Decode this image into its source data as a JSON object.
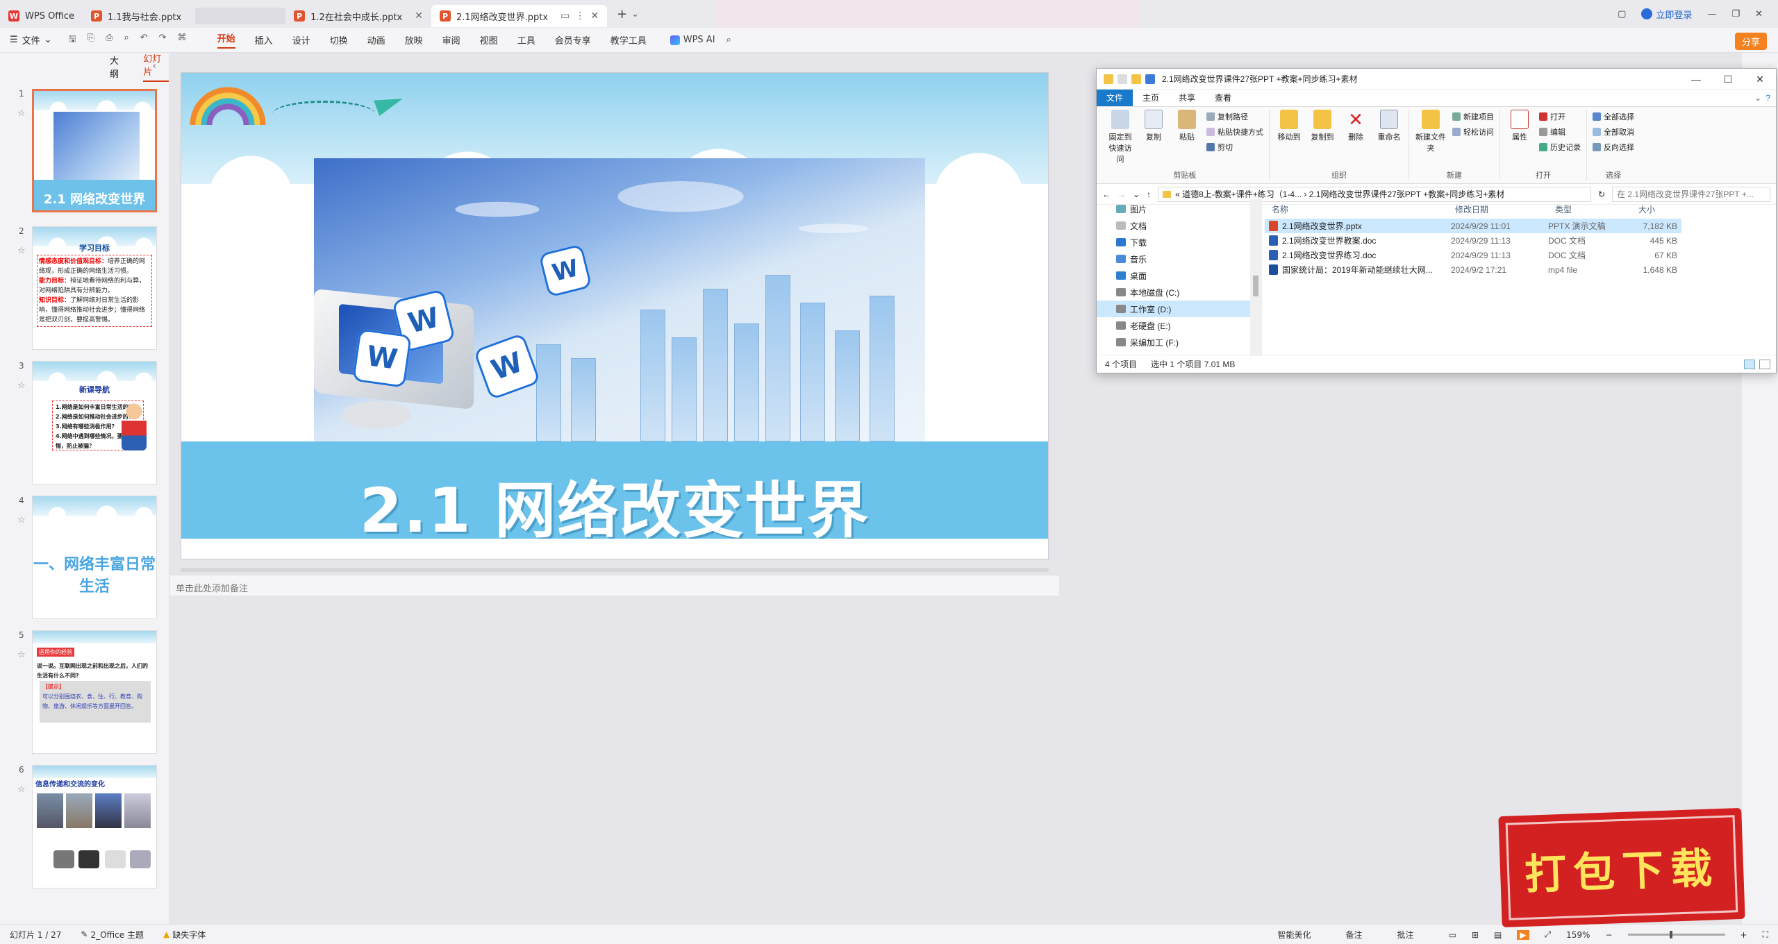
{
  "titlebar": {
    "tabs": [
      {
        "label": "WPS Office",
        "kind": "wps"
      },
      {
        "label": "1.1我与社会.pptx",
        "kind": "ppt"
      },
      {
        "label": "1.2在社会中成长.pptx",
        "kind": "ppt"
      },
      {
        "label": "2.1网络改变世界.pptx",
        "kind": "ppt",
        "active": true
      }
    ],
    "login": "立即登录"
  },
  "ribbon": {
    "file_menu": "文件",
    "tabs": [
      "开始",
      "插入",
      "设计",
      "切换",
      "动画",
      "放映",
      "审阅",
      "视图",
      "工具",
      "会员专享",
      "教学工具"
    ],
    "active_tab": "开始",
    "wps_ai": "WPS AI",
    "share": "分享"
  },
  "left_panel": {
    "tabs": [
      "大纲",
      "幻灯片"
    ],
    "active": "幻灯片",
    "slides": [
      {
        "num": "1",
        "title": "2.1 网络改变世界"
      },
      {
        "num": "2",
        "heading": "学习目标",
        "lines": [
          {
            "label": "情感态度和价值观目标：",
            "text": "培养正确的网络观，形成正确的网络生活习惯。"
          },
          {
            "label": "能力目标：",
            "text": "辩证地看待网络的利与弊，对网络陷阱具有分辨能力。"
          },
          {
            "label": "知识目标：",
            "text": "了解网络对日常生活的影响，懂得网络推动社会进步；懂得网络是把双刃剑，要提高警惕。"
          }
        ]
      },
      {
        "num": "3",
        "heading": "新课导航",
        "items": [
          "1.网络是如何丰富日常生活的？",
          "2.网络是如何推动社会进步的？",
          "3.网络有哪些消极作用？",
          "4.网络中遇到哪些情况，要提高警惕，防止被骗？"
        ]
      },
      {
        "num": "4",
        "title": "一、网络丰富日常生活"
      },
      {
        "num": "5",
        "tag": "运用你的经验",
        "question": "说一说。互联网出现之前和出现之后，人们的生活有什么不同?",
        "hint_label": "【提示】",
        "hint": "可以分别围绕衣、食、住、行、教育、购物、旅游、休闲娱乐等方面展开回答。"
      },
      {
        "num": "6",
        "heading": "信息传递和交流的变化"
      }
    ]
  },
  "slide": {
    "title": "2.1 网络改变世界"
  },
  "notes_placeholder": "单击此处添加备注",
  "statusbar": {
    "slide_count": "幻灯片 1 / 27",
    "theme": "2_Office 主题",
    "missing_font": "缺失字体",
    "beautify": "智能美化",
    "notes": "备注",
    "comment": "批注",
    "zoom": "159%"
  },
  "explorer": {
    "title": "2.1网络改变世界课件27张PPT +教案+同步练习+素材",
    "tabs": [
      "文件",
      "主页",
      "共享",
      "查看"
    ],
    "ribbon": {
      "clipboard": {
        "label": "剪贴板",
        "pin": "固定到快速访问",
        "copy": "复制",
        "paste": "粘贴",
        "copy_path": "复制路径",
        "paste_shortcut": "粘贴快捷方式",
        "cut": "剪切"
      },
      "organize": {
        "label": "组织",
        "move_to": "移动到",
        "copy_to": "复制到",
        "delete": "删除",
        "rename": "重命名"
      },
      "new": {
        "label": "新建",
        "new_folder": "新建文件夹",
        "new_item": "新建项目",
        "easy_access": "轻松访问"
      },
      "open": {
        "label": "打开",
        "properties": "属性",
        "open": "打开",
        "edit": "编辑",
        "history": "历史记录"
      },
      "select": {
        "label": "选择",
        "select_all": "全部选择",
        "select_none": "全部取消",
        "invert": "反向选择"
      }
    },
    "address": "« 道德8上-教案+课件+练习（1-4... › 2.1网络改变世界课件27张PPT +教案+同步练习+素材",
    "search_placeholder": "在 2.1网络改变世界课件27张PPT +...",
    "nav": [
      "图片",
      "文档",
      "下载",
      "音乐",
      "桌面",
      "本地磁盘 (C:)",
      "工作室 (D:)",
      "老硬盘 (E:)",
      "采编加工 (F:)"
    ],
    "nav_selected": "工作室 (D:)",
    "columns": [
      "名称",
      "修改日期",
      "类型",
      "大小"
    ],
    "files": [
      {
        "name": "2.1网络改变世界.pptx",
        "date": "2024/9/29 11:01",
        "type": "PPTX 演示文稿",
        "size": "7,182 KB",
        "icon": "ppt",
        "selected": true
      },
      {
        "name": "2.1网络改变世界教案.doc",
        "date": "2024/9/29 11:13",
        "type": "DOC 文档",
        "size": "445 KB",
        "icon": "doc"
      },
      {
        "name": "2.1网络改变世界练习.doc",
        "date": "2024/9/29 11:13",
        "type": "DOC 文档",
        "size": "67 KB",
        "icon": "doc"
      },
      {
        "name": "国家统计局：2019年新动能继续壮大网...",
        "date": "2024/9/2 17:21",
        "type": "mp4 file",
        "size": "1,648 KB",
        "icon": "mp4"
      }
    ],
    "status": {
      "count": "4 个项目",
      "selected": "选中 1 个项目  7.01 MB"
    }
  },
  "stamp": {
    "text": "打包下载"
  }
}
